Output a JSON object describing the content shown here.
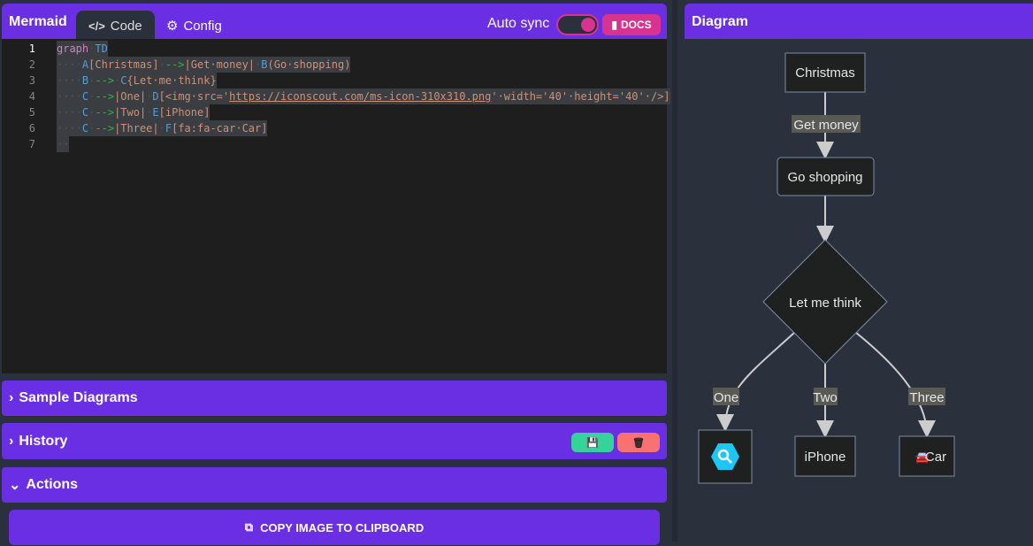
{
  "app": {
    "brand": "Mermaid",
    "tabs": [
      {
        "label": "Code",
        "icon": "code-icon",
        "active": true
      },
      {
        "label": "Config",
        "icon": "gears-icon"
      }
    ],
    "auto_sync_label": "Auto sync",
    "auto_sync_on": true,
    "docs_label": "DOCS",
    "accent": "#6a2ee3",
    "pink": "#d8338f"
  },
  "editor": {
    "line_numbers": [
      "1",
      "2",
      "3",
      "4",
      "5",
      "6",
      "7"
    ],
    "lines": [
      [
        [
          "kw",
          "graph"
        ],
        [
          "ws",
          "·"
        ],
        [
          "id",
          "TD"
        ]
      ],
      [
        [
          "ws",
          "····"
        ],
        [
          "id",
          "A"
        ],
        [
          "tx",
          "[Christmas]"
        ],
        [
          "ws",
          "·"
        ],
        [
          "ar",
          "-->"
        ],
        [
          "tx",
          "|Get·money|"
        ],
        [
          "ws",
          "·"
        ],
        [
          "id",
          "B"
        ],
        [
          "tx",
          "(Go·shopping)"
        ]
      ],
      [
        [
          "ws",
          "····"
        ],
        [
          "id",
          "B"
        ],
        [
          "ws",
          "·"
        ],
        [
          "ar",
          "-->"
        ],
        [
          "ws",
          "·"
        ],
        [
          "id",
          "C"
        ],
        [
          "tx",
          "{Let·me·think}"
        ]
      ],
      [
        [
          "ws",
          "····"
        ],
        [
          "id",
          "C"
        ],
        [
          "ws",
          "·"
        ],
        [
          "ar",
          "-->"
        ],
        [
          "tx",
          "|One|"
        ],
        [
          "ws",
          "·"
        ],
        [
          "id",
          "D"
        ],
        [
          "tx",
          "[<img·src='"
        ],
        [
          "url",
          "https://iconscout.com/ms-icon-310x310.png"
        ],
        [
          "tx",
          "'·width='40'·height='40'·/>]"
        ]
      ],
      [
        [
          "ws",
          "····"
        ],
        [
          "id",
          "C"
        ],
        [
          "ws",
          "·"
        ],
        [
          "ar",
          "-->"
        ],
        [
          "tx",
          "|Two|"
        ],
        [
          "ws",
          "·"
        ],
        [
          "id",
          "E"
        ],
        [
          "tx",
          "[iPhone]"
        ]
      ],
      [
        [
          "ws",
          "····"
        ],
        [
          "id",
          "C"
        ],
        [
          "ws",
          "·"
        ],
        [
          "ar",
          "-->"
        ],
        [
          "tx",
          "|Three|"
        ],
        [
          "ws",
          "·"
        ],
        [
          "id",
          "F"
        ],
        [
          "tx",
          "[fa:fa-car·Car]"
        ]
      ],
      [
        [
          "ws",
          "··"
        ]
      ]
    ]
  },
  "sections": {
    "sample": "Sample Diagrams",
    "history": "History",
    "actions": "Actions",
    "copy": "COPY IMAGE TO CLIPBOARD"
  },
  "diagram": {
    "title": "Diagram",
    "nodes": {
      "a": "Christmas",
      "b": "Go shopping",
      "c": "Let me think",
      "e": "iPhone",
      "f": "Car"
    },
    "edges": {
      "ab": "Get money",
      "cd": "One",
      "ce": "Two",
      "cf": "Three"
    }
  }
}
